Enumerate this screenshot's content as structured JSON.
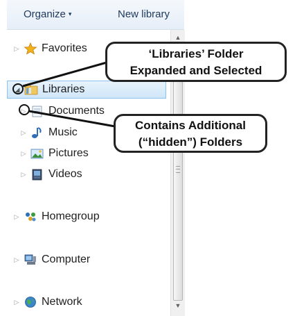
{
  "toolbar": {
    "organize_label": "Organize",
    "organize_caret": "▾",
    "new_library_label": "New library"
  },
  "nav": {
    "items": [
      {
        "label": "Favorites",
        "expander": "▷",
        "icon": "star-icon"
      },
      {
        "label": "Libraries",
        "expander": "◢",
        "icon": "libraries-folder-icon",
        "selected": true
      },
      {
        "label": "Documents",
        "expander": "▷",
        "icon": "documents-icon"
      },
      {
        "label": "Music",
        "expander": "▷",
        "icon": "music-icon"
      },
      {
        "label": "Pictures",
        "expander": "▷",
        "icon": "pictures-icon"
      },
      {
        "label": "Videos",
        "expander": "▷",
        "icon": "videos-icon"
      },
      {
        "label": "Homegroup",
        "expander": "▷",
        "icon": "homegroup-icon"
      },
      {
        "label": "Computer",
        "expander": "▷",
        "icon": "computer-icon"
      },
      {
        "label": "Network",
        "expander": "▷",
        "icon": "network-icon"
      }
    ]
  },
  "scrollbar": {
    "up_arrow": "▲",
    "down_arrow": "▼"
  },
  "callouts": {
    "libraries_line1": "‘Libraries’ Folder",
    "libraries_line2": "Expanded and Selected",
    "hidden_line1": "Contains Additional",
    "hidden_line2": "(“hidden”) Folders"
  },
  "colors": {
    "toolbar_text": "#1e395b",
    "selection_border": "#8cc3ee",
    "selection_fill": "#cfe6f9"
  }
}
